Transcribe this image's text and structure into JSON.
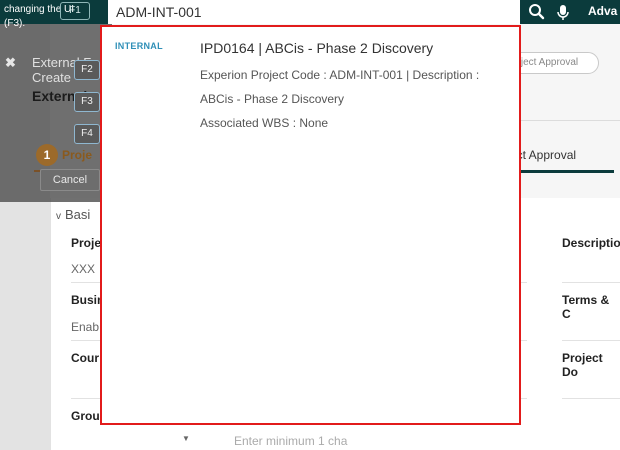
{
  "topbar": {
    "hint_line1": "changing the UI",
    "hint_line2": "(F3).",
    "f1_label": "F1",
    "search_value": "ADM-INT-001",
    "advanced_label": "Adva"
  },
  "modal": {
    "close": "✖",
    "external_title": "External F",
    "create": "Create",
    "external_bold": "External",
    "keys": [
      "F2",
      "F3",
      "F4"
    ],
    "step_number": "1",
    "step_label": "Proje",
    "cancel_label": "Cancel"
  },
  "page": {
    "approval_chip": "roject Approval",
    "approval_tab": "ect Approval",
    "basic_section": "Basi",
    "fields_left": [
      {
        "label": "Proje",
        "value": "XXX"
      },
      {
        "label": "Busin",
        "value": "Enab"
      },
      {
        "label": "Cour",
        "value": ""
      },
      {
        "label": "Grou",
        "value": ""
      }
    ],
    "fields_right": [
      {
        "label": "Descriptio"
      },
      {
        "label": "Terms & C"
      },
      {
        "label": "Project Do"
      }
    ],
    "enter_min": "Enter minimum 1 cha"
  },
  "results": [
    {
      "tag": "INTERNAL",
      "title": "IPD0164 | ABCis - Phase 2 Discovery",
      "line1": "Experion Project Code : ADM-INT-001 | Description :",
      "line2": "ABCis - Phase 2 Discovery",
      "line3": "Associated WBS : None"
    }
  ],
  "colors": {
    "topbar": "#0b3b3c",
    "highlight_border": "#e21b1b",
    "tag": "#2f8fb7"
  }
}
